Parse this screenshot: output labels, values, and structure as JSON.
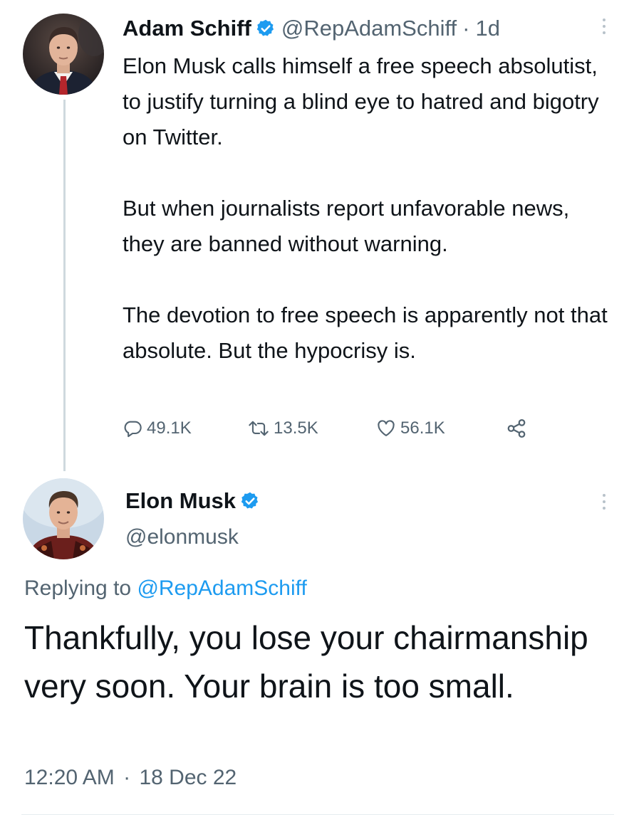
{
  "parent_tweet": {
    "author_name": "Adam Schiff",
    "author_handle": "@RepAdamSchiff",
    "separator": "·",
    "age": "1d",
    "verified": true,
    "paragraphs": [
      "Elon Musk calls himself a free speech absolutist, to justify turning a blind eye to hatred and bigotry on Twitter.",
      "But when journalists report unfavorable news, they are banned without warning.",
      "The devotion to free speech is apparently not that absolute. But the hypocrisy is."
    ],
    "stats": {
      "replies": "49.1K",
      "retweets": "13.5K",
      "likes": "56.1K"
    },
    "icons": [
      "reply-icon",
      "retweet-icon",
      "like-icon",
      "share-icon",
      "more-icon",
      "verified-badge-icon"
    ]
  },
  "reply_tweet": {
    "author_name": "Elon Musk",
    "author_handle": "@elonmusk",
    "verified": true,
    "replying_prefix": "Replying to",
    "replying_to": "@RepAdamSchiff",
    "text": "Thankfully, you lose your chairmanship very soon. Your brain is too small.",
    "time": "12:20 AM",
    "date_separator": "·",
    "date": "18 Dec 22"
  },
  "colors": {
    "text_primary": "#0f1419",
    "text_secondary": "#536471",
    "link_blue": "#1d9bf0",
    "verified_blue": "#1d9bf0",
    "thread_line": "#cfd9de"
  }
}
